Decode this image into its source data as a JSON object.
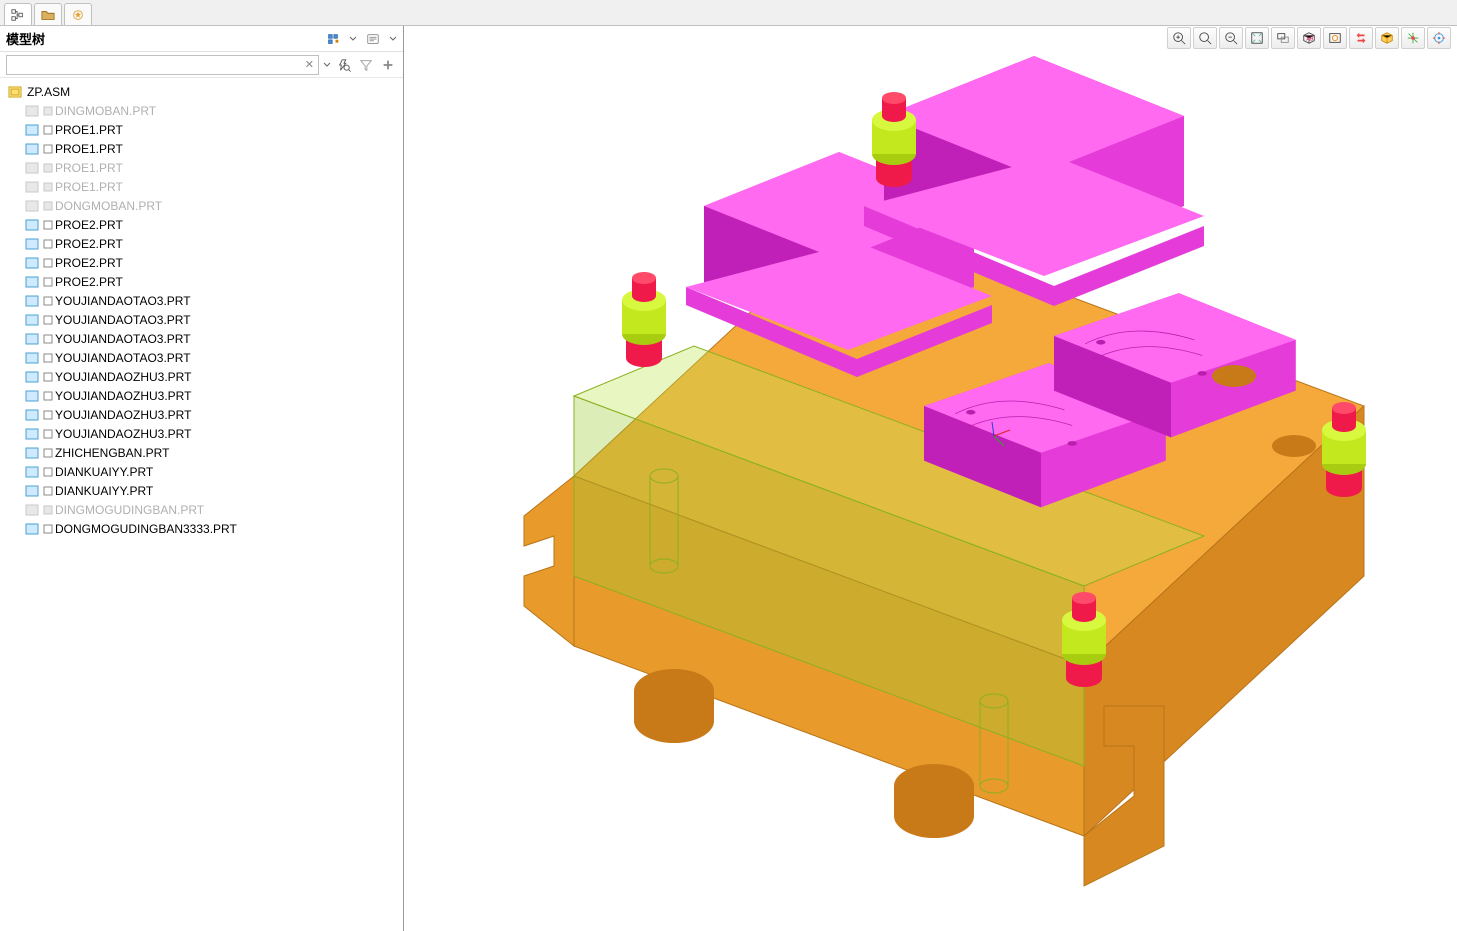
{
  "tabs": {
    "tab1_name": "model-tree-tab",
    "tab2_name": "layers-tab",
    "tab3_name": "favorites-tab"
  },
  "sidebar": {
    "title": "模型树",
    "search_placeholder": "",
    "search_value": ""
  },
  "tree": {
    "root": "ZP.ASM",
    "items": [
      {
        "label": "DINGMOBAN.PRT",
        "dim": true
      },
      {
        "label": "PROE1.PRT",
        "dim": false
      },
      {
        "label": "PROE1.PRT",
        "dim": false
      },
      {
        "label": "PROE1.PRT",
        "dim": true
      },
      {
        "label": "PROE1.PRT",
        "dim": true
      },
      {
        "label": "DONGMOBAN.PRT",
        "dim": true
      },
      {
        "label": "PROE2.PRT",
        "dim": false
      },
      {
        "label": "PROE2.PRT",
        "dim": false
      },
      {
        "label": "PROE2.PRT",
        "dim": false
      },
      {
        "label": "PROE2.PRT",
        "dim": false
      },
      {
        "label": "YOUJIANDAOTAO3.PRT",
        "dim": false
      },
      {
        "label": "YOUJIANDAOTAO3.PRT",
        "dim": false
      },
      {
        "label": "YOUJIANDAOTAO3.PRT",
        "dim": false
      },
      {
        "label": "YOUJIANDAOTAO3.PRT",
        "dim": false
      },
      {
        "label": "YOUJIANDAOZHU3.PRT",
        "dim": false
      },
      {
        "label": "YOUJIANDAOZHU3.PRT",
        "dim": false
      },
      {
        "label": "YOUJIANDAOZHU3.PRT",
        "dim": false
      },
      {
        "label": "YOUJIANDAOZHU3.PRT",
        "dim": false
      },
      {
        "label": "ZHICHENGBAN.PRT",
        "dim": false
      },
      {
        "label": "DIANKUAIYY.PRT",
        "dim": false
      },
      {
        "label": "DIANKUAIYY.PRT",
        "dim": false
      },
      {
        "label": "DINGMOGUDINGBAN.PRT",
        "dim": true
      },
      {
        "label": "DONGMOGUDINGBAN3333.PRT",
        "dim": false
      }
    ]
  },
  "view_toolbar": {
    "btns": [
      "zoom-in-icon",
      "zoom-fit-icon",
      "zoom-out-icon",
      "refit-icon",
      "box-zoom-icon",
      "named-views-icon",
      "saved-orient-icon",
      "reorient-icon",
      "display-style-icon",
      "datum-display-icon",
      "spin-center-icon"
    ]
  },
  "colors": {
    "plate": "#e89b2b",
    "plate_dark": "#c87a18",
    "block_pink": "#e43bd9",
    "block_pink_dark": "#b81faf",
    "pin_green": "#c4e81e",
    "pin_red": "#ef1a49",
    "trans_green": "rgba(154,204,50,0.35)"
  }
}
